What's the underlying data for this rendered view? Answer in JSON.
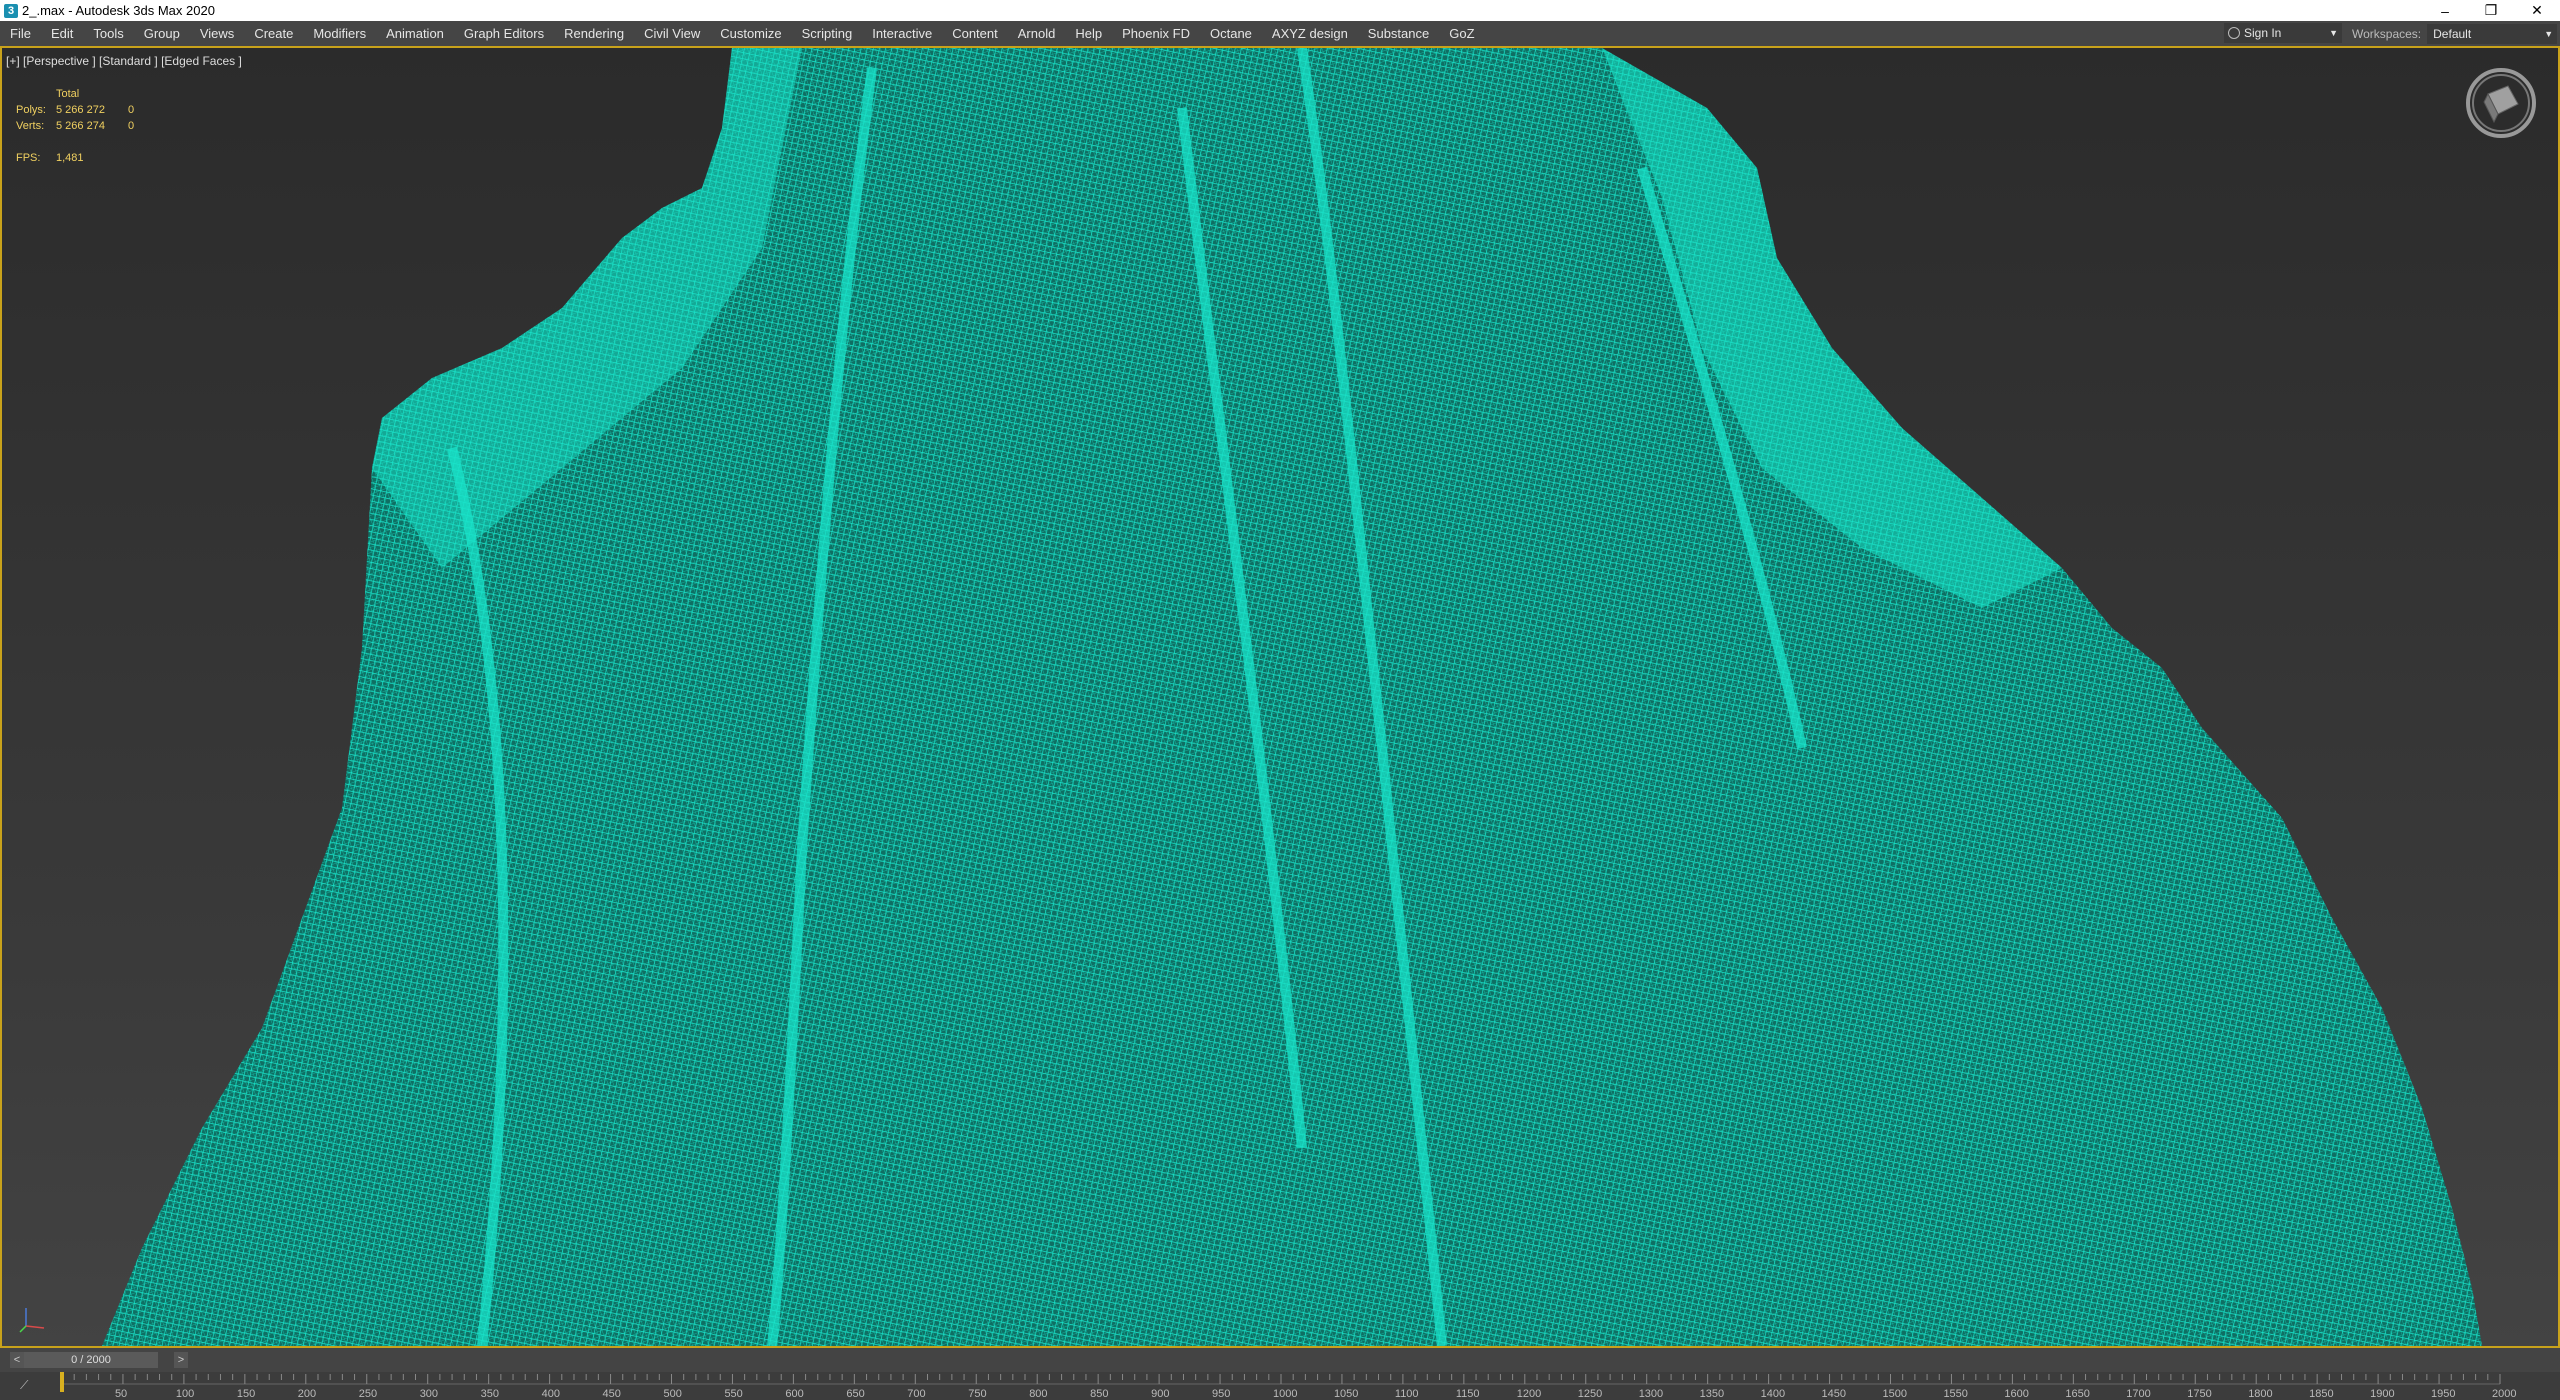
{
  "titlebar": {
    "icon": "3ds-max-icon",
    "title": "2_.max - Autodesk 3ds Max 2020",
    "minimize": "–",
    "restore": "❐",
    "close": "✕"
  },
  "menubar": {
    "items": [
      "File",
      "Edit",
      "Tools",
      "Group",
      "Views",
      "Create",
      "Modifiers",
      "Animation",
      "Graph Editors",
      "Rendering",
      "Civil View",
      "Customize",
      "Scripting",
      "Interactive",
      "Content",
      "Arnold",
      "Help",
      "Phoenix FD",
      "Octane",
      "AXYZ design",
      "Substance",
      "GoZ"
    ],
    "signin_label": "Sign In",
    "workspaces_label": "Workspaces:",
    "workspace_value": "Default"
  },
  "viewport": {
    "label": "[+] [Perspective ] [Standard ] [Edged Faces ]",
    "stats": {
      "total_label": "Total",
      "polys_label": "Polys:",
      "polys_value": "5 266 272",
      "polys_sel": "0",
      "verts_label": "Verts:",
      "verts_value": "5 266 274",
      "verts_sel": "0",
      "fps_label": "FPS:",
      "fps_value": "1,481"
    },
    "mesh_color": "#19e3c9",
    "border_color": "#c8a21b"
  },
  "timeslider": {
    "prev": "<",
    "next": ">",
    "position": "0 / 2000"
  },
  "trackbar": {
    "ticks": [
      "50",
      "100",
      "150",
      "200",
      "250",
      "300",
      "350",
      "400",
      "450",
      "500",
      "550",
      "600",
      "650",
      "700",
      "750",
      "800",
      "850",
      "900",
      "950",
      "1000",
      "1050",
      "1100",
      "1150",
      "1200",
      "1250",
      "1300",
      "1350",
      "1400",
      "1450",
      "1500",
      "1550",
      "1600",
      "1650",
      "1700",
      "1750",
      "1800",
      "1850",
      "1900",
      "1950",
      "2000"
    ]
  }
}
